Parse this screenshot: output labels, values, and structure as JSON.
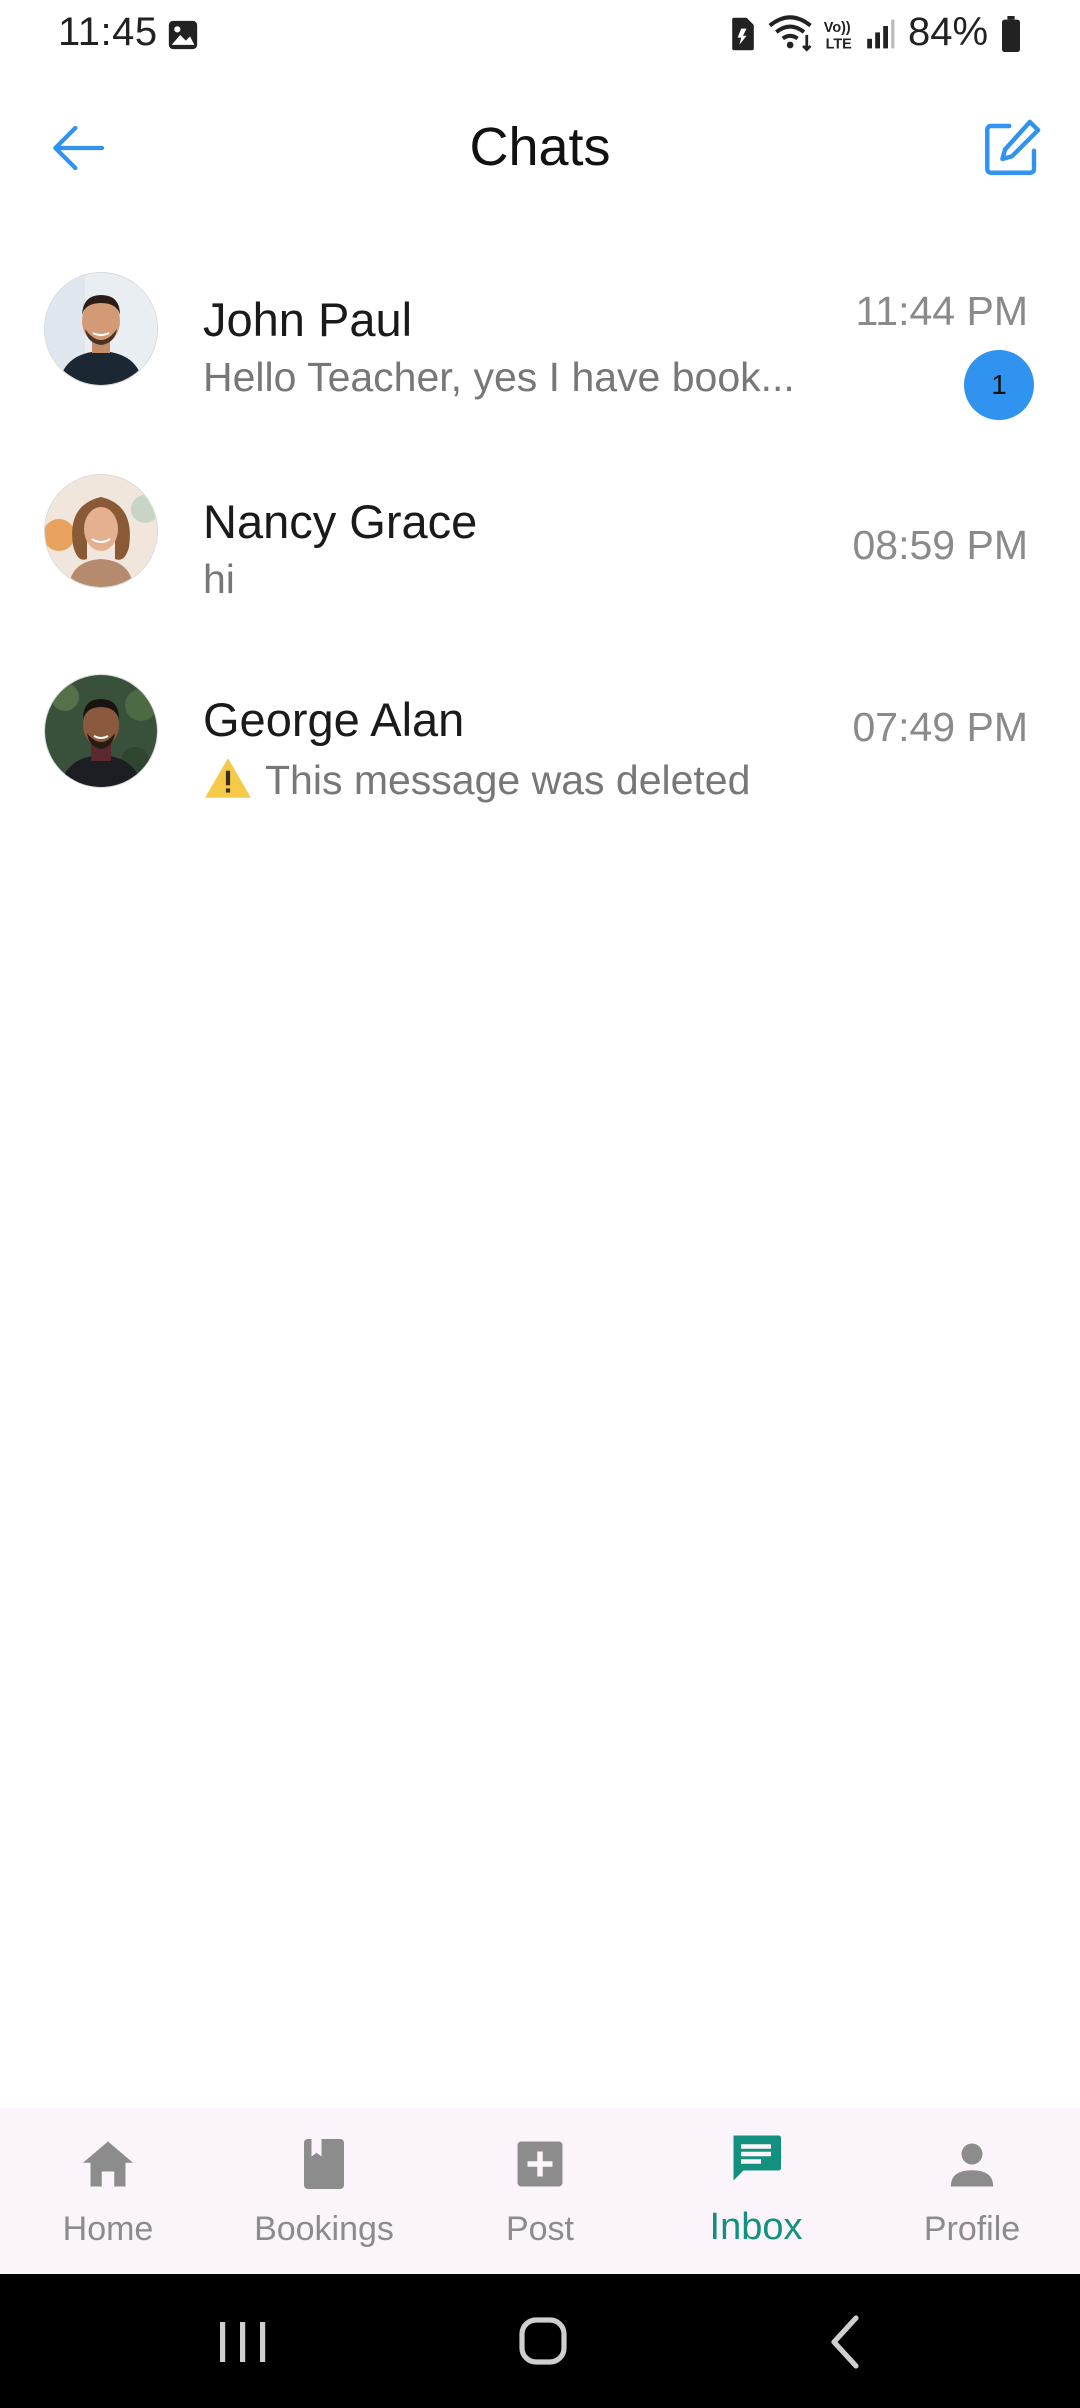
{
  "status_bar": {
    "time": "11:45",
    "battery": "84%",
    "icons": [
      "gallery-icon",
      "sim-icon",
      "wifi-icon",
      "volte-icon",
      "signal-icon",
      "battery-icon"
    ]
  },
  "header": {
    "title": "Chats",
    "back_icon": "arrow-left-icon",
    "compose_icon": "compose-icon"
  },
  "chats": [
    {
      "name": "John Paul",
      "preview": "Hello Teacher, yes I have book...",
      "time": "11:44 PM",
      "unread": "1"
    },
    {
      "name": "Nancy Grace",
      "preview": "hi",
      "time": "08:59 PM"
    },
    {
      "name": "George Alan",
      "preview": "This message was deleted",
      "time": "07:49 PM",
      "preview_icon": "warning-icon"
    }
  ],
  "bottom_nav": {
    "items": [
      {
        "label": "Home",
        "icon": "home-icon"
      },
      {
        "label": "Bookings",
        "icon": "bookmark-icon"
      },
      {
        "label": "Post",
        "icon": "add-box-icon"
      },
      {
        "label": "Inbox",
        "icon": "chat-icon",
        "active": true
      },
      {
        "label": "Profile",
        "icon": "person-icon"
      }
    ]
  },
  "colors": {
    "accent_blue": "#2f93ef",
    "active_nav": "#14907e",
    "nav_bg": "#fbf4fb"
  }
}
